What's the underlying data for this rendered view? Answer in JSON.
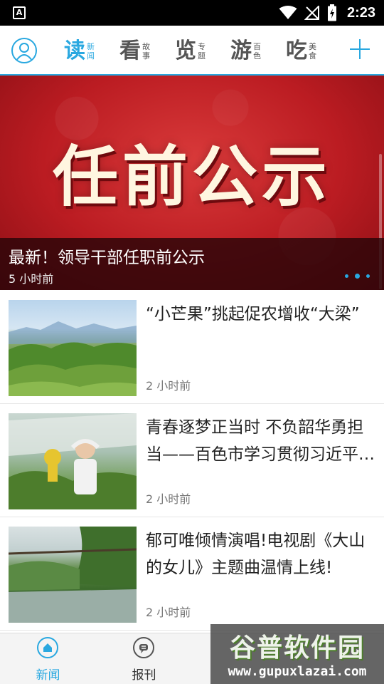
{
  "status_bar": {
    "app_badge": "A",
    "time": "2:23",
    "icons": [
      "wifi-icon",
      "no-signal-icon",
      "battery-charging-icon"
    ]
  },
  "header": {
    "tabs": [
      {
        "main": "读",
        "sub": "新闻",
        "active": true
      },
      {
        "main": "看",
        "sub": "故事",
        "active": false
      },
      {
        "main": "览",
        "sub": "专题",
        "active": false
      },
      {
        "main": "游",
        "sub": "百色",
        "active": false
      },
      {
        "main": "吃",
        "sub": "美食",
        "active": false
      }
    ],
    "accent_color": "#29a8e0"
  },
  "banner": {
    "image_text": "任前公示",
    "title": "最新！领导干部任职前公示",
    "time": "5 小时前",
    "dots": 3,
    "active_dot": 1
  },
  "news": [
    {
      "title": "“小芒果”挑起促农增收“大梁”",
      "time": "2 小时前"
    },
    {
      "title": "青春逐梦正当时 不负韶华勇担当——百色市学习贯彻习近平新时代中国特色社会主义思想",
      "time": "2 小时前"
    },
    {
      "title": "郁可唯倾情演唱!电视剧《大山的女儿》主题曲温情上线!",
      "time": "2 小时前"
    }
  ],
  "bottom_nav": {
    "items": [
      {
        "label": "新闻",
        "icon": "home-icon",
        "active": true
      },
      {
        "label": "报刊",
        "icon": "newspaper-icon",
        "active": false
      },
      {
        "label": "",
        "icon": "hidden-icon",
        "active": false
      },
      {
        "label": "",
        "icon": "hidden-icon",
        "active": false
      }
    ]
  },
  "watermark": {
    "cn": "谷普软件园",
    "en": "www.gupuxlazai.com"
  }
}
